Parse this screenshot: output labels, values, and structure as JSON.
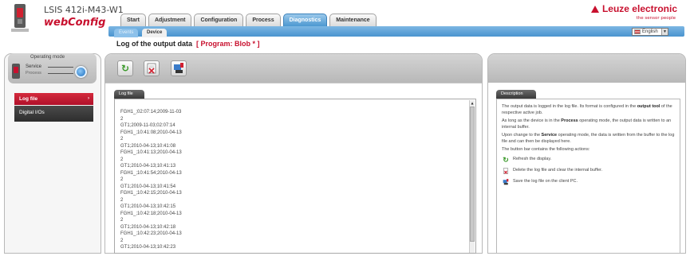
{
  "header": {
    "product_name": "LSIS 412i-M43-W1",
    "app_name": "webConfig",
    "brand": "Leuze electronic",
    "slogan": "the sensor people"
  },
  "tabs": [
    {
      "label": "Start",
      "active": false
    },
    {
      "label": "Adjustment",
      "active": false
    },
    {
      "label": "Configuration",
      "active": false
    },
    {
      "label": "Process",
      "active": false
    },
    {
      "label": "Diagnostics",
      "active": true
    },
    {
      "label": "Maintenance",
      "active": false
    }
  ],
  "subtabs": {
    "events": "Events",
    "device": "Device"
  },
  "language": {
    "selected": "English"
  },
  "page": {
    "title": "Log of the output data",
    "program": "[ Program: Blob * ]"
  },
  "operating_mode": {
    "title": "Operating mode",
    "service": "Service",
    "process": "Process"
  },
  "left_menu": {
    "log_file": "Log file",
    "digital_ios": "Digital I/Os",
    "arrow": "›"
  },
  "log": {
    "tab_label": "Log file",
    "lines": [
      "FGH1_;02:07:14;2009-11-03",
      "2",
      "GT1;2009-11-03;02:07:14",
      "FGH1_;10:41:08;2010-04-13",
      "2",
      "GT1;2010-04-13;10:41:08",
      "FGH1_;10:41:13;2010-04-13",
      "2",
      "GT1;2010-04-13;10:41:13",
      "FGH1_;10:41:54;2010-04-13",
      "2",
      "GT1;2010-04-13;10:41:54",
      "FGH1_;10:42:15;2010-04-13",
      "2",
      "GT1;2010-04-13;10:42:15",
      "FGH1_;10:42:18;2010-04-13",
      "2",
      "GT1;2010-04-13;10:42:18",
      "FGH1_;10:42:23;2010-04-13",
      "2",
      "GT1;2010-04-13;10:42:23"
    ]
  },
  "description": {
    "tab_label": "Description",
    "p1_a": "The output data is logged in the log file. Its format is configured in the ",
    "p1_b": "output tool",
    "p1_c": " of the respective active job.",
    "p2_a": "As long as the device is in the ",
    "p2_b": "Process",
    "p2_c": " operating mode, the output data is written to an internal buffer.",
    "p3_a": "Upon change to the ",
    "p3_b": "Service",
    "p3_c": " operating mode, the data is written from the buffer to the log file and can then be displayed here.",
    "p4": "The button bar contains the following actions:",
    "action_refresh": "Refresh the display.",
    "action_delete": "Delete the log file and clear the internal buffer.",
    "action_save": "Save the log file on the client PC."
  },
  "colors": {
    "accent_red": "#c8102e",
    "tab_blue": "#4c98d1"
  },
  "icons": {
    "refresh": "refresh-icon",
    "delete": "delete-log-icon",
    "save": "save-icon"
  }
}
